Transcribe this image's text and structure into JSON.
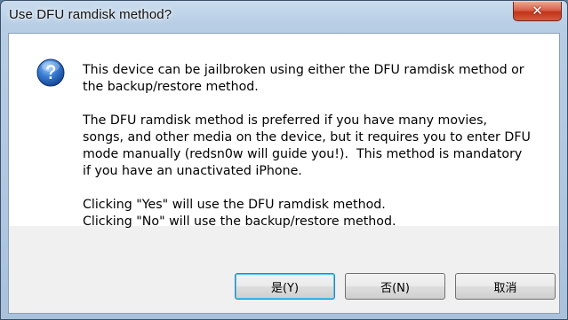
{
  "dialog": {
    "title": "Use DFU ramdisk method?",
    "close_symbol": "✕",
    "icon": "question-icon",
    "message": {
      "paragraph1": "This device can be jailbroken using either the DFU ramdisk method or\nthe backup/restore method.",
      "paragraph2": "The DFU ramdisk method is preferred if you have many movies,\nsongs, and other media on the device, but it requires you to enter DFU\nmode manually (redsn0w will guide you!).  This method is mandatory\nif you have an unactivated iPhone.",
      "paragraph3": "Clicking \"Yes\" will use the DFU ramdisk method.\nClicking \"No\" will use the backup/restore method."
    },
    "buttons": {
      "yes": "是(Y)",
      "no": "否(N)",
      "cancel": "取消"
    }
  },
  "colors": {
    "close_button": "#c1341a",
    "icon_blue": "#1f5fb5",
    "default_button_border": "#3c7fb1"
  }
}
